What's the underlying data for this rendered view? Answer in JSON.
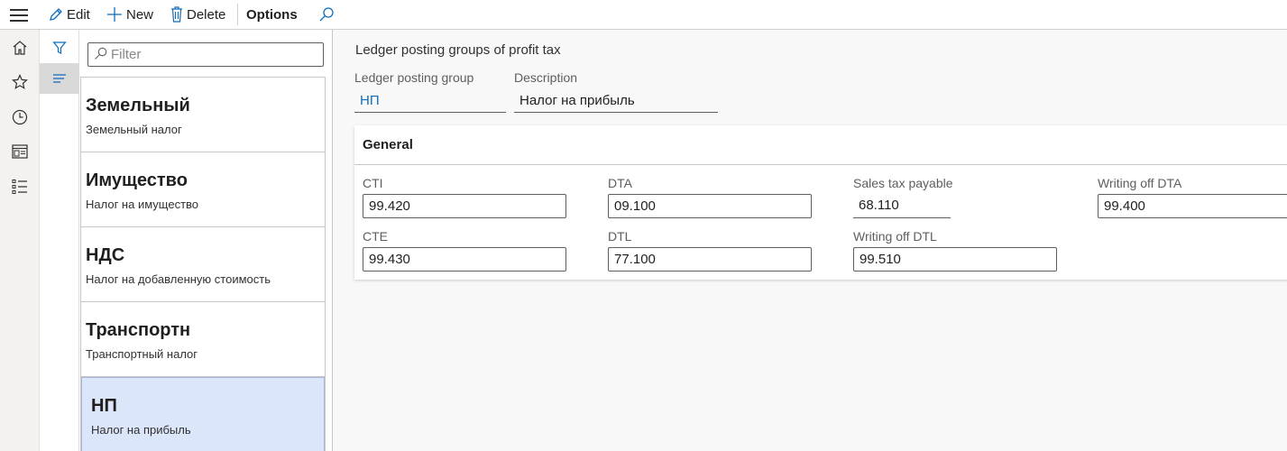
{
  "toolbar": {
    "edit_label": "Edit",
    "new_label": "New",
    "delete_label": "Delete",
    "options_label": "Options"
  },
  "filter": {
    "placeholder": "Filter"
  },
  "list": {
    "items": [
      {
        "title": "Земельный",
        "subtitle": "Земельный налог"
      },
      {
        "title": "Имущество",
        "subtitle": "Налог на имущество"
      },
      {
        "title": "НДС",
        "subtitle": "Налог на добавленную стоимость"
      },
      {
        "title": "Транспортн",
        "subtitle": "Транспортный налог"
      },
      {
        "title": "НП",
        "subtitle": "Налог на прибыль",
        "selected": true
      }
    ]
  },
  "detail": {
    "caption": "Ledger posting groups of profit tax",
    "group_label": "Ledger posting group",
    "group_value": "НП",
    "description_label": "Description",
    "description_value": "Налог на прибыль",
    "section_title": "General",
    "fields": {
      "cti": {
        "label": "CTI",
        "value": "99.420"
      },
      "dta": {
        "label": "DTA",
        "value": "09.100"
      },
      "sales_tax": {
        "label": "Sales tax payable",
        "value": "68.110"
      },
      "writing_off_dta": {
        "label": "Writing off DTA",
        "value": "99.400"
      },
      "cte": {
        "label": "CTE",
        "value": "99.430"
      },
      "dtl": {
        "label": "DTL",
        "value": "77.100"
      },
      "writing_off_dtl": {
        "label": "Writing off DTL",
        "value": "99.510"
      }
    }
  },
  "colors": {
    "accent": "#0f6cbd",
    "selected_bg": "#dce6fa"
  },
  "icons": [
    "hamburger-icon",
    "edit-icon",
    "new-icon",
    "delete-icon",
    "search-icon",
    "home-icon",
    "star-icon",
    "clock-icon",
    "workspace-icon",
    "list-icon",
    "filter-icon"
  ]
}
